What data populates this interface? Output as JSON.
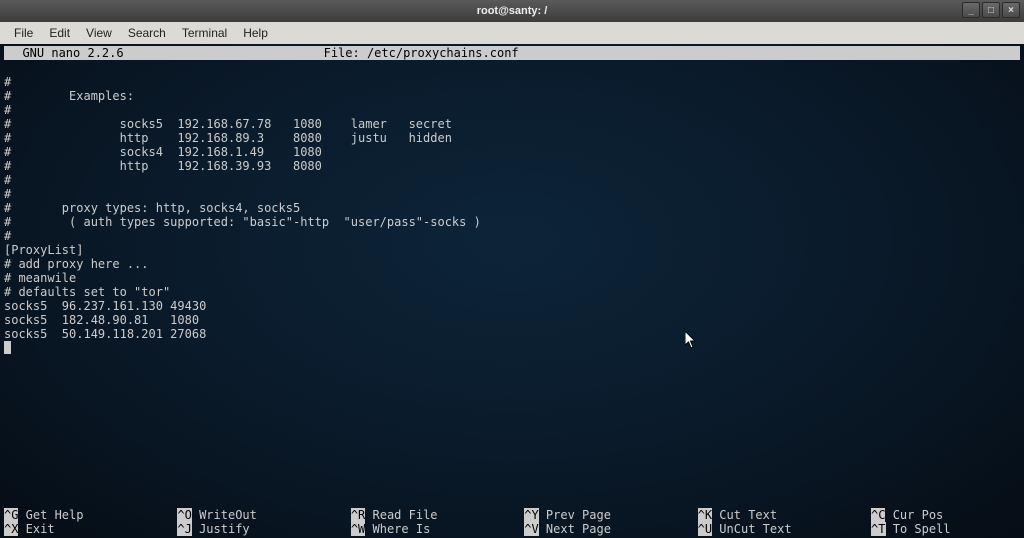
{
  "titlebar": {
    "title": "root@santy: /"
  },
  "window_controls": {
    "minimize": "_",
    "maximize": "□",
    "close": "×"
  },
  "menubar": {
    "items": [
      "File",
      "Edit",
      "View",
      "Search",
      "Terminal",
      "Help"
    ]
  },
  "nano": {
    "app_name": "  GNU nano 2.2.6",
    "file_label": "File: /etc/proxychains.conf"
  },
  "editor": {
    "lines": [
      "#",
      "#        Examples:",
      "#",
      "#               socks5  192.168.67.78   1080    lamer   secret",
      "#               http    192.168.89.3    8080    justu   hidden",
      "#               socks4  192.168.1.49    1080",
      "#               http    192.168.39.93   8080",
      "#",
      "#",
      "#       proxy types: http, socks4, socks5",
      "#        ( auth types supported: \"basic\"-http  \"user/pass\"-socks )",
      "#",
      "[ProxyList]",
      "# add proxy here ...",
      "# meanwile",
      "# defaults set to \"tor\"",
      "socks5  96.237.161.130 49430",
      "socks5  182.48.90.81   1080",
      "socks5  50.149.118.201 27068"
    ]
  },
  "shortcuts": {
    "row1": [
      {
        "key": "^G",
        "label": " Get Help"
      },
      {
        "key": "^O",
        "label": " WriteOut"
      },
      {
        "key": "^R",
        "label": " Read File"
      },
      {
        "key": "^Y",
        "label": " Prev Page"
      },
      {
        "key": "^K",
        "label": " Cut Text"
      },
      {
        "key": "^C",
        "label": " Cur Pos"
      }
    ],
    "row2": [
      {
        "key": "^X",
        "label": " Exit"
      },
      {
        "key": "^J",
        "label": " Justify"
      },
      {
        "key": "^W",
        "label": " Where Is"
      },
      {
        "key": "^V",
        "label": " Next Page"
      },
      {
        "key": "^U",
        "label": " UnCut Text"
      },
      {
        "key": "^T",
        "label": " To Spell"
      }
    ]
  }
}
